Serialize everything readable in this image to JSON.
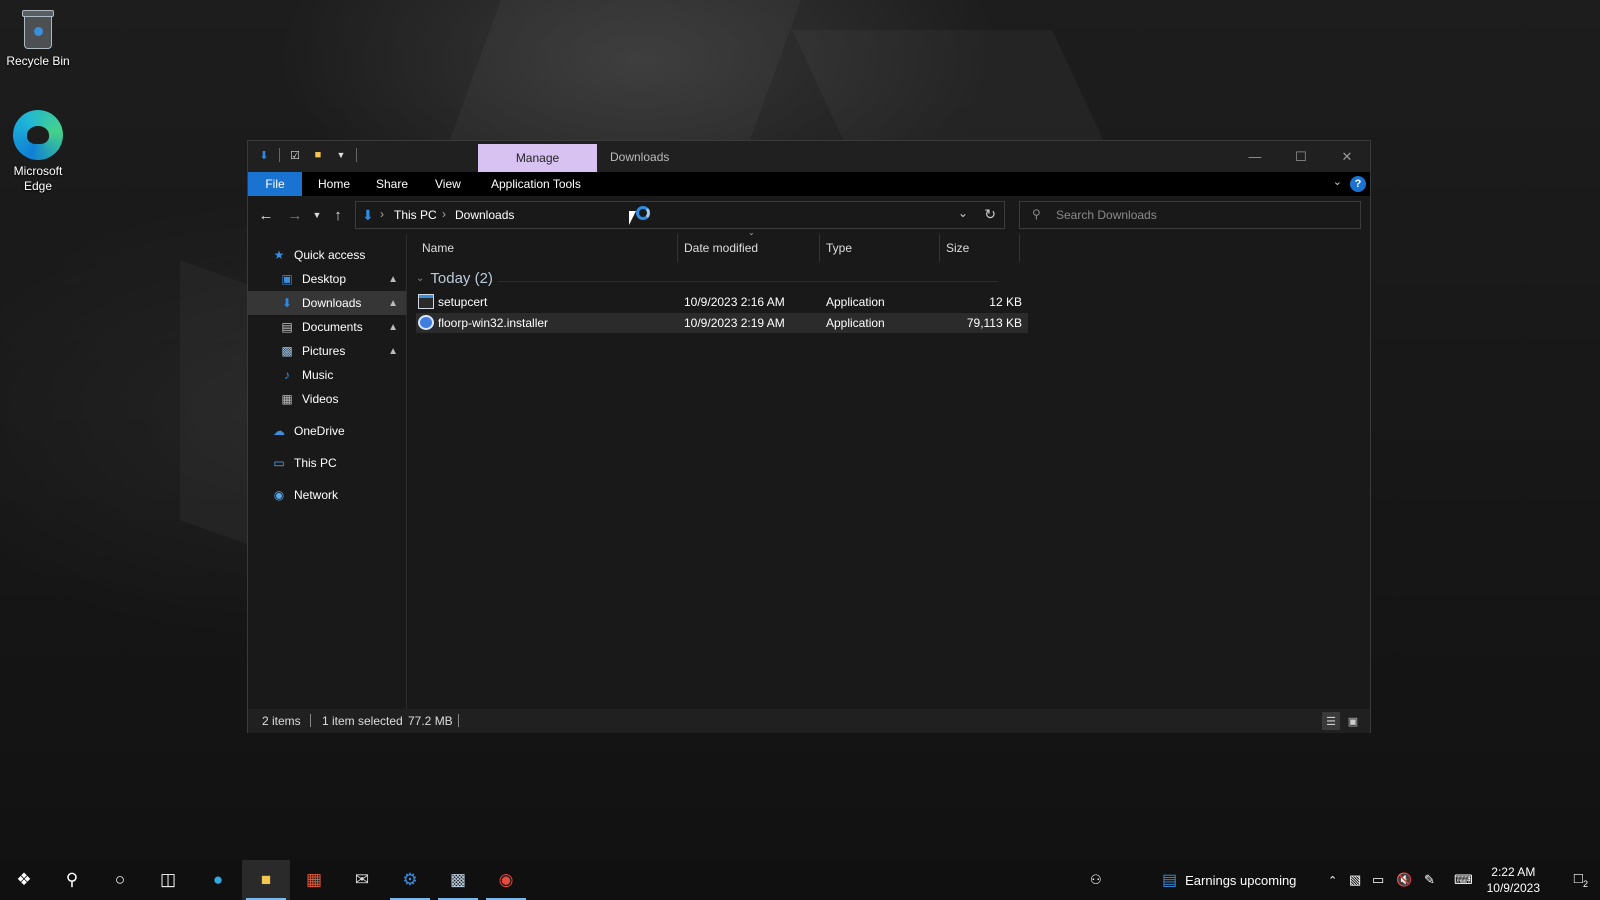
{
  "desktop": {
    "icons": [
      {
        "label": "Recycle Bin"
      },
      {
        "label": "Microsoft Edge"
      }
    ]
  },
  "window": {
    "title": "Downloads",
    "contextual_tab": "Manage",
    "ribbon_tabs": [
      "File",
      "Home",
      "Share",
      "View",
      "Application Tools"
    ],
    "help": "?"
  },
  "address": {
    "crumbs": [
      "This PC",
      "Downloads"
    ]
  },
  "search": {
    "placeholder": "Search Downloads"
  },
  "navpane": {
    "items": [
      {
        "label": "Quick access",
        "icon": "star-icon",
        "pinned": false
      },
      {
        "label": "Desktop",
        "icon": "desktop-folder-icon",
        "pinned": true
      },
      {
        "label": "Downloads",
        "icon": "download-arrow-icon",
        "pinned": true,
        "active": true
      },
      {
        "label": "Documents",
        "icon": "documents-icon",
        "pinned": true
      },
      {
        "label": "Pictures",
        "icon": "pictures-icon",
        "pinned": true
      },
      {
        "label": "Music",
        "icon": "music-icon",
        "pinned": false
      },
      {
        "label": "Videos",
        "icon": "videos-icon",
        "pinned": false
      },
      {
        "label": "OneDrive",
        "icon": "cloud-icon",
        "pinned": false
      },
      {
        "label": "This PC",
        "icon": "computer-icon",
        "pinned": false
      },
      {
        "label": "Network",
        "icon": "network-icon",
        "pinned": false
      }
    ]
  },
  "columns": [
    "Name",
    "Date modified",
    "Type",
    "Size"
  ],
  "group": {
    "label": "Today (2)"
  },
  "files": [
    {
      "name": "setupcert",
      "date": "10/9/2023 2:16 AM",
      "type": "Application",
      "size": "12 KB",
      "icon": "application-icon",
      "selected": false
    },
    {
      "name": "floorp-win32.installer",
      "date": "10/9/2023 2:19 AM",
      "type": "Application",
      "size": "79,113 KB",
      "icon": "floorp-icon",
      "selected": true
    }
  ],
  "status": {
    "items": "2 items",
    "selected": "1 item selected",
    "size": "77.2 MB"
  },
  "taskbar": {
    "weather": "Earnings upcoming",
    "time": "2:22 AM",
    "date": "10/9/2023",
    "notification_count": "2"
  },
  "colors": {
    "accent": "#1a73d1",
    "manage_tab": "#d8c2f2",
    "window_bg": "#191919",
    "taskbar_bg": "#101010"
  }
}
